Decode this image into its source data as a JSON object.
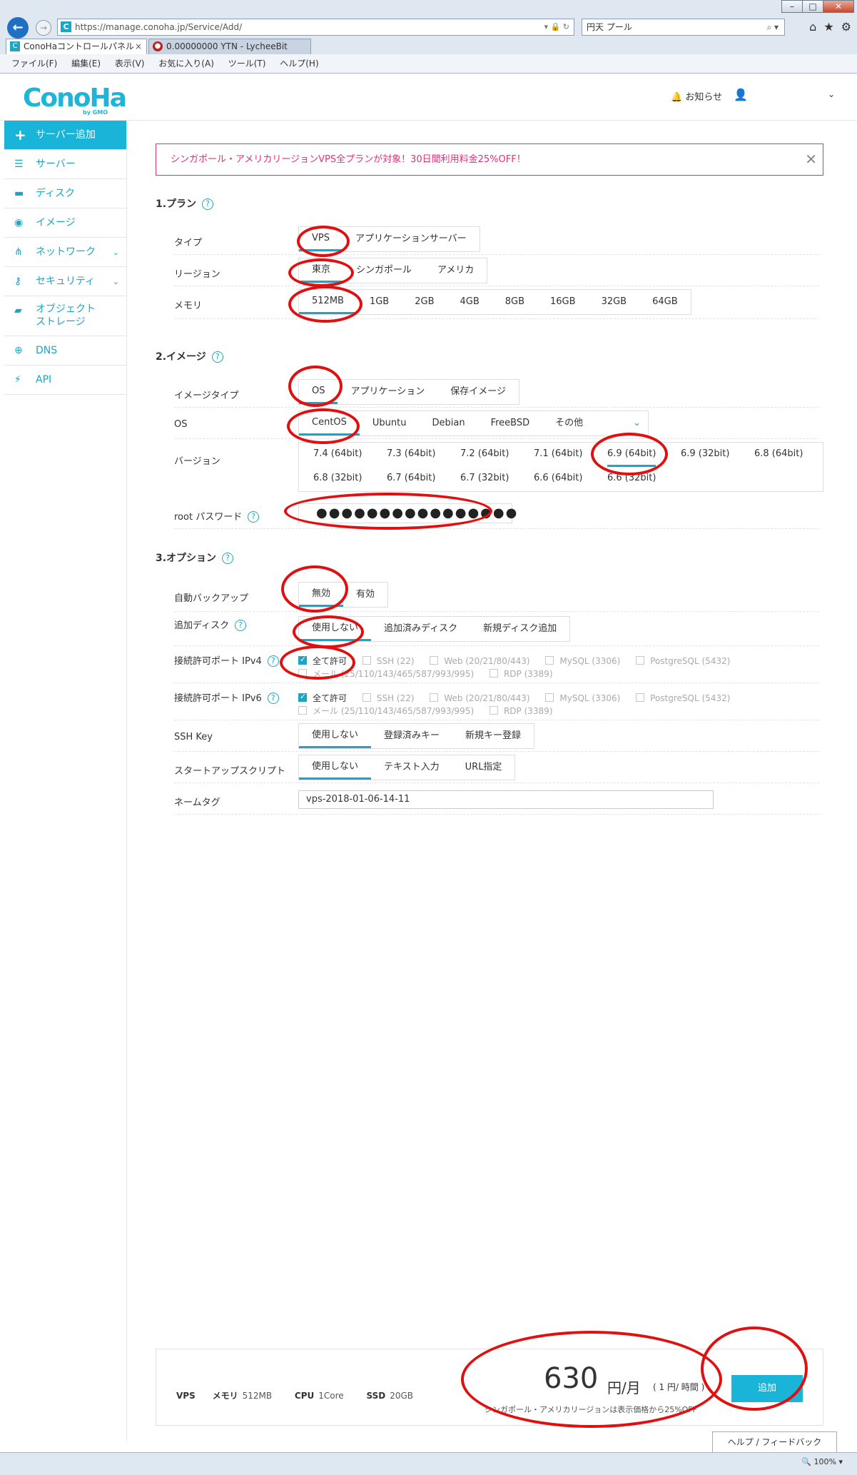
{
  "browser": {
    "url": "https://manage.conoha.jp/Service/Add/",
    "search_value": "円天 プール",
    "tabs": [
      {
        "label": "ConoHaコントロールパネル",
        "active": true
      },
      {
        "label": "0.00000000 YTN - LycheeBit",
        "active": false
      }
    ],
    "menu": [
      "ファイル(F)",
      "編集(E)",
      "表示(V)",
      "お気に入り(A)",
      "ツール(T)",
      "ヘルプ(H)"
    ],
    "zoom": "100%"
  },
  "header": {
    "logo": "ConoHa",
    "logo_sub": "by GMO",
    "notice": "お知らせ"
  },
  "sidebar": {
    "items": [
      {
        "label": "サーバー追加",
        "icon": "plus-icon"
      },
      {
        "label": "サーバー",
        "icon": "server-icon"
      },
      {
        "label": "ディスク",
        "icon": "disk-icon"
      },
      {
        "label": "イメージ",
        "icon": "globe-icon"
      },
      {
        "label": "ネットワーク",
        "icon": "network-icon"
      },
      {
        "label": "セキュリティ",
        "icon": "key-icon"
      },
      {
        "label": "オブジェクト",
        "label2": "ストレージ",
        "icon": "folder-icon"
      },
      {
        "label": "DNS",
        "icon": "dns-icon"
      },
      {
        "label": "API",
        "icon": "api-icon"
      }
    ]
  },
  "banner": "シンガポール・アメリカリージョンVPS全プランが対象！30日間利用料金25%OFF！",
  "plan": {
    "title": "1.プラン",
    "type_label": "タイプ",
    "types": [
      "VPS",
      "アプリケーションサーバー"
    ],
    "region_label": "リージョン",
    "regions": [
      "東京",
      "シンガポール",
      "アメリカ"
    ],
    "memory_label": "メモリ",
    "memories": [
      "512MB",
      "1GB",
      "2GB",
      "4GB",
      "8GB",
      "16GB",
      "32GB",
      "64GB"
    ]
  },
  "image": {
    "title": "2.イメージ",
    "type_label": "イメージタイプ",
    "types": [
      "OS",
      "アプリケーション",
      "保存イメージ"
    ],
    "os_label": "OS",
    "os": [
      "CentOS",
      "Ubuntu",
      "Debian",
      "FreeBSD",
      "その他"
    ],
    "version_label": "バージョン",
    "versions": [
      "7.4 (64bit)",
      "7.3 (64bit)",
      "7.2 (64bit)",
      "7.1 (64bit)",
      "6.9 (64bit)",
      "6.9 (32bit)",
      "6.8 (64bit)",
      "6.8 (32bit)",
      "6.7 (64bit)",
      "6.7 (32bit)",
      "6.6 (64bit)",
      "6.6 (32bit)"
    ],
    "password_label": "root パスワード",
    "password_value": "●●●●●●●●●●●●●●●●"
  },
  "option": {
    "title": "3.オプション",
    "backup_label": "自動バックアップ",
    "backup": [
      "無効",
      "有効"
    ],
    "disk_label": "追加ディスク",
    "disk": [
      "使用しない",
      "追加済みディスク",
      "新規ディスク追加"
    ],
    "ipv4_label": "接続許可ポート IPv4",
    "ipv6_label": "接続許可ポート IPv6",
    "ports_line1": [
      "全て許可",
      "SSH (22)",
      "Web (20/21/80/443)",
      "MySQL (3306)",
      "PostgreSQL (5432)"
    ],
    "ports_line2": [
      "メール (25/110/143/465/587/993/995)",
      "RDP (3389)"
    ],
    "sshkey_label": "SSH Key",
    "sshkey": [
      "使用しない",
      "登録済みキー",
      "新規キー登録"
    ],
    "startup_label": "スタートアップスクリプト",
    "startup": [
      "使用しない",
      "テキスト入力",
      "URL指定"
    ],
    "nametag_label": "ネームタグ",
    "nametag_value": "vps-2018-01-06-14-11"
  },
  "summary": {
    "vps": "VPS",
    "mem_label": "メモリ",
    "mem_value": "512MB",
    "cpu_label": "CPU",
    "cpu_value": "1Core",
    "ssd_label": "SSD",
    "ssd_value": "20GB",
    "price": "630",
    "price_unit": "円/月",
    "price_hour": "( 1 円/ 時間 )",
    "price_note": "シンガポール・アメリカリージョンは表示価格から25%OFF",
    "add_button": "追加",
    "feedback": "ヘルプ / フィードバック"
  },
  "colors": {
    "accent": "#1aa7c5",
    "banner": "#e0307a",
    "annotation": "#e01010"
  }
}
